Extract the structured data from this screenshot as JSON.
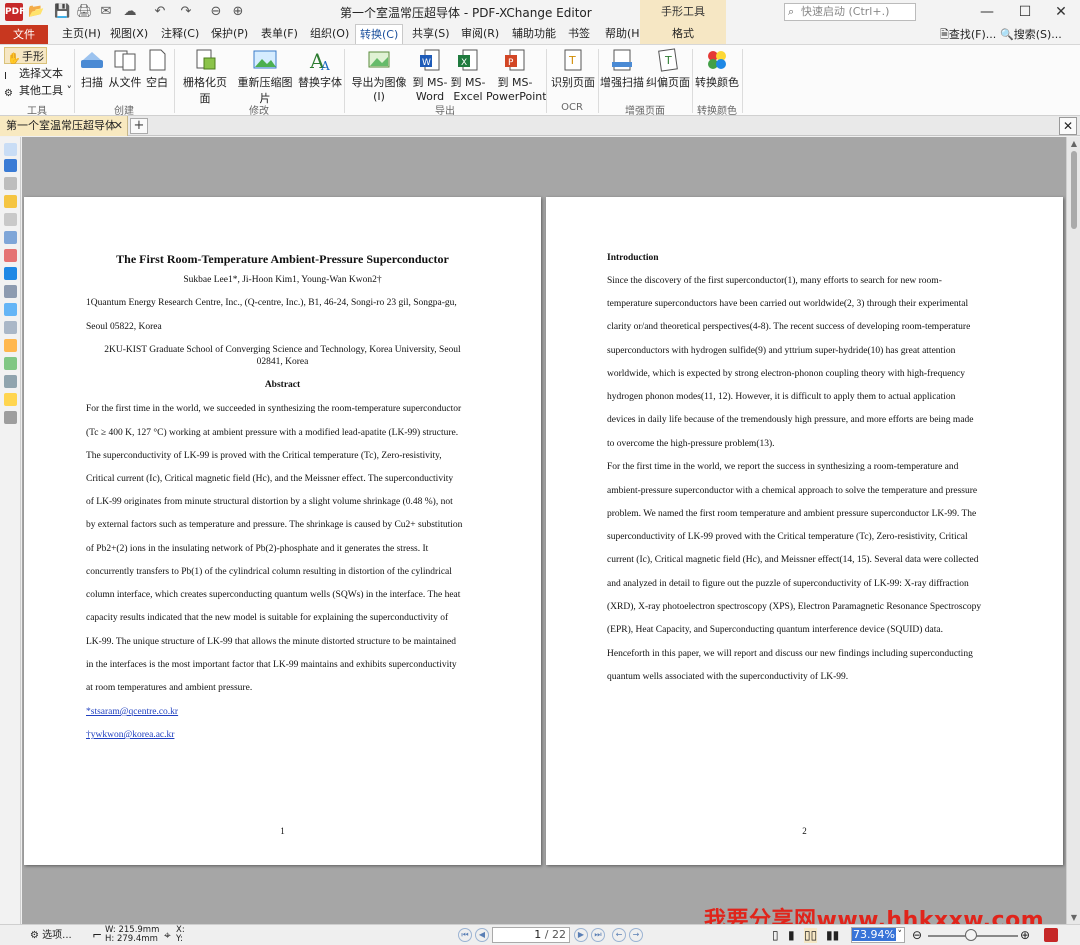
{
  "window": {
    "title": "第一个室温常压超导体 - PDF-XChange Editor",
    "app_logo": "PDF",
    "context_tool_tab": "手形工具",
    "quick_launch_placeholder": "快速启动 (Ctrl+.)",
    "minimize": "—",
    "maximize": "☐",
    "close": "✕"
  },
  "quick_access": [
    "📂",
    "💾",
    "🖨",
    "✉",
    "☁",
    "↶",
    "↷",
    "⊖",
    "⊕"
  ],
  "menu": {
    "file": "文件",
    "items": [
      "主页(H)",
      "视图(X)",
      "注释(C)",
      "保护(P)",
      "表单(F)",
      "组织(O)",
      "转换(C)",
      "共享(S)",
      "审阅(R)",
      "辅助功能",
      "书签",
      "帮助(H)"
    ],
    "active_index": 6,
    "context_format": "格式",
    "find": "查找(F)...",
    "search": "搜索(S)..."
  },
  "ribbon": {
    "tools_group": {
      "label": "工具",
      "items": [
        "手形",
        "选择文本",
        "其他工具"
      ]
    },
    "create_group": {
      "label": "创建",
      "items": [
        "扫描",
        "从文件",
        "空白"
      ]
    },
    "modify_group": {
      "label": "修改",
      "items": [
        "栅格化页面",
        "重新压缩图片",
        "替换字体"
      ]
    },
    "export_group": {
      "label": "导出",
      "items": [
        "导出为图像(I)",
        "到 MS-Word",
        "到 MS-Excel",
        "到 MS-PowerPoint"
      ]
    },
    "ocr_group": {
      "label": "OCR",
      "items": [
        "识别页面"
      ]
    },
    "enhance_group": {
      "label": "增强页面",
      "items": [
        "增强扫描",
        "纠偏页面"
      ]
    },
    "convert_color_group": {
      "label": "转换颜色",
      "items": [
        "转换颜色"
      ]
    }
  },
  "tabs": {
    "document_tab": "第一个室温常压超导体",
    "add": "+",
    "close_all": "✕"
  },
  "page1": {
    "title": "The First Room-Temperature Ambient-Pressure Superconductor",
    "authors": "Sukbae Lee1*, Ji-Hoon Kim1, Young-Wan Kwon2†",
    "affil1_a": "1Quantum Energy Research Centre, Inc., (Q-centre, Inc.), B1, 46-24, Songi-ro 23 gil, Songpa-gu,",
    "affil1_b": "Seoul 05822, Korea",
    "affil2_a": "2KU-KIST Graduate School of Converging Science and Technology, Korea University, Seoul",
    "affil2_b": "02841, Korea",
    "abstract_heading": "Abstract",
    "abstract_lines": [
      "For the first time in the world, we succeeded in synthesizing the room-temperature superconductor",
      "(Tc ≥ 400 K, 127 °C) working at ambient pressure with a modified lead-apatite (LK-99) structure.",
      "The superconductivity of LK-99 is proved with the Critical temperature (Tc), Zero-resistivity,",
      "Critical current (Ic), Critical magnetic field (Hc), and the Meissner effect. The superconductivity",
      "of LK-99 originates from minute structural distortion by a slight volume shrinkage (0.48 %), not",
      "by external factors such as temperature and pressure. The shrinkage is caused by Cu2+ substitution",
      "of Pb2+(2) ions in the insulating network of Pb(2)-phosphate and it generates the stress. It",
      "concurrently transfers to Pb(1) of the cylindrical column resulting in distortion of the cylindrical",
      "column interface, which creates superconducting quantum wells (SQWs) in the interface. The heat",
      "capacity results indicated that the new model is suitable for explaining the superconductivity of",
      "LK-99. The unique structure of LK-99 that allows the minute distorted structure to be maintained",
      "in the interfaces is the most important factor that LK-99 maintains and exhibits superconductivity",
      "at room temperatures and ambient pressure."
    ],
    "email1": "*stsaram@qcentre.co.kr",
    "email2": "†ywkwon@korea.ac.kr",
    "page_number": "1"
  },
  "page2": {
    "heading": "Introduction",
    "lines": [
      "    Since the discovery of the first superconductor(1), many efforts to search for new room-",
      "temperature superconductors have been carried out worldwide(2, 3) through their experimental",
      "clarity or/and theoretical perspectives(4-8). The recent success of developing room-temperature",
      "superconductors with hydrogen sulfide(9) and yttrium super-hydride(10) has great attention",
      "worldwide, which is expected by strong electron-phonon coupling theory with high-frequency",
      "hydrogen phonon modes(11, 12). However, it is difficult to apply them to actual application",
      "devices in daily life because of the tremendously high pressure, and more efforts are being made",
      "to overcome the high-pressure problem(13).",
      "    For the first time in the world, we report the success in synthesizing a room-temperature and",
      "ambient-pressure superconductor with a chemical approach to solve the temperature and pressure",
      "problem. We named the first room temperature and ambient pressure superconductor LK-99. The",
      "superconductivity of LK-99 proved with the Critical temperature (Tc), Zero-resistivity, Critical",
      "current (Ic), Critical magnetic field (Hc), and Meissner effect(14, 15). Several data were collected",
      "and analyzed in detail to figure out the puzzle of superconductivity of LK-99: X-ray diffraction",
      "(XRD), X-ray photoelectron spectroscopy (XPS), Electron Paramagnetic Resonance Spectroscopy",
      "(EPR), Heat Capacity, and Superconducting quantum interference device (SQUID) data.",
      "Henceforth in this paper, we will report and discuss our new findings including superconducting",
      "quantum wells associated with the superconductivity of LK-99."
    ],
    "page_number": "2"
  },
  "status": {
    "options": "选项...",
    "width": "W: 215.9mm",
    "height": "H: 279.4mm",
    "x": "X:",
    "y": "Y:",
    "page_current": "1",
    "page_total": "/ 22",
    "zoom": "73.94%",
    "zoom_fraction": 0.48
  },
  "watermark": "我要分享网www.hhkxxw.com",
  "colors": {
    "file_tab": "#c8371f",
    "context_tab": "#f6e7c4",
    "link": "#1f3fbf",
    "watermark": "#e0241b"
  }
}
